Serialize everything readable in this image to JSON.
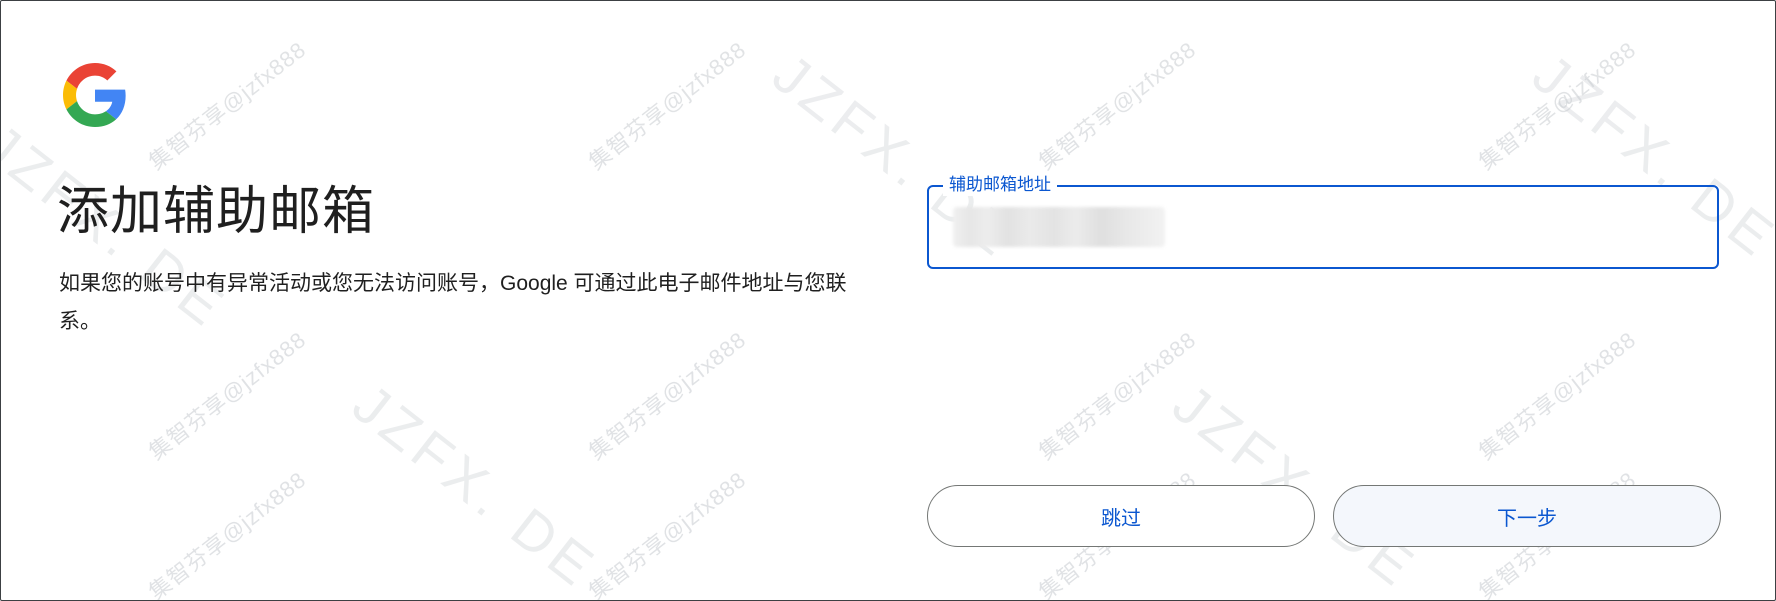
{
  "brand": {
    "logo_icon": "google-g-logo-icon",
    "colors": {
      "blue": "#4285F4",
      "red": "#EA4335",
      "yellow": "#FBBC05",
      "green": "#34A853",
      "accent": "#0b57d0"
    }
  },
  "page": {
    "title": "添加辅助邮箱",
    "description": "如果您的账号中有异常活动或您无法访问账号，Google 可通过此电子邮件地址与您联系。"
  },
  "recovery_email": {
    "label": "辅助邮箱地址",
    "value": ""
  },
  "actions": {
    "skip_label": "跳过",
    "next_label": "下一步"
  },
  "watermark": {
    "text_small": "集智芬享@jzfx888",
    "text_big": "JZFX. DE"
  }
}
